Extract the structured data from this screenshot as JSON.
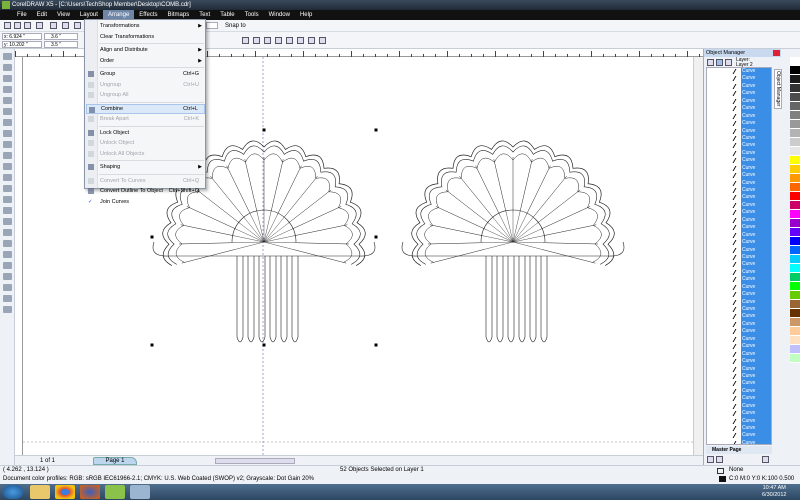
{
  "window": {
    "title": "CorelDRAW X5 - [C:\\Users\\TechShop Member\\Desktop\\COMB.cdr]"
  },
  "menubar": [
    "File",
    "Edit",
    "View",
    "Layout",
    "Arrange",
    "Effects",
    "Bitmaps",
    "Text",
    "Table",
    "Tools",
    "Window",
    "Help"
  ],
  "toolbar": {
    "snap_to": "Snap to"
  },
  "propbar": {
    "x": "x: 6.924 \"",
    "y": "y: 10.202 \"",
    "w": "3.6 \"",
    "h": "3.5 \""
  },
  "arrange_menu": [
    {
      "label": "Transformations",
      "submenu": true,
      "enabled": true
    },
    {
      "label": "Clear Transformations",
      "enabled": true
    },
    {
      "sep": true
    },
    {
      "label": "Align and Distribute",
      "submenu": true,
      "enabled": true
    },
    {
      "label": "Order",
      "submenu": true,
      "enabled": true
    },
    {
      "sep": true
    },
    {
      "label": "Group",
      "shortcut": "Ctrl+G",
      "enabled": true
    },
    {
      "label": "Ungroup",
      "shortcut": "Ctrl+U",
      "enabled": false
    },
    {
      "label": "Ungroup All",
      "enabled": false
    },
    {
      "sep": true
    },
    {
      "label": "Combine",
      "shortcut": "Ctrl+L",
      "enabled": true,
      "highlighted": true
    },
    {
      "label": "Break Apart",
      "shortcut": "Ctrl+K",
      "enabled": false
    },
    {
      "sep": true
    },
    {
      "label": "Lock Object",
      "enabled": true
    },
    {
      "label": "Unlock Object",
      "enabled": false
    },
    {
      "label": "Unlock All Objects",
      "enabled": false
    },
    {
      "sep": true
    },
    {
      "label": "Shaping",
      "submenu": true,
      "enabled": true
    },
    {
      "sep": true
    },
    {
      "label": "Convert To Curves",
      "shortcut": "Ctrl+Q",
      "enabled": false
    },
    {
      "label": "Convert Outline To Object",
      "shortcut": "Ctrl+Shift+Q",
      "enabled": true
    },
    {
      "label": "Join Curves",
      "enabled": true,
      "checked": true
    }
  ],
  "object_manager": {
    "title": "Object Manager",
    "layer_label": "Layer:",
    "layer": "Layer 2",
    "item_label": "Curve",
    "item_count": 52,
    "master_page": "Master Page",
    "side_tab": "Object Manager"
  },
  "pagebar": {
    "page_count": "1 of 1",
    "page_tab": "Page 1"
  },
  "status": {
    "coords": "( 4.262 , 13.124 )",
    "selection": "52 Objects Selected on Layer 1",
    "color_profiles": "Document color profiles: RGB: sRGB IEC61966-2.1; CMYK: U.S. Web Coated (SWOP) v2; Grayscale: Dot Gain 20%",
    "fill": "None",
    "outline": "C:0 M:0 Y:0 K:100  0.500 pt"
  },
  "taskbar": {
    "time": "10:47 AM",
    "date": "6/30/2012"
  },
  "palette": [
    "#ffffff",
    "#000000",
    "#1a1a1a",
    "#333333",
    "#4d4d4d",
    "#666666",
    "#808080",
    "#999999",
    "#b3b3b3",
    "#cccccc",
    "#e6e6e6",
    "#ffff00",
    "#ffcc00",
    "#ff9900",
    "#ff6600",
    "#ff0000",
    "#cc0066",
    "#ff00ff",
    "#9900cc",
    "#6600ff",
    "#0000ff",
    "#0066ff",
    "#00ccff",
    "#00ffff",
    "#00cc66",
    "#00ff00",
    "#66cc00",
    "#996633",
    "#663300",
    "#cc9966",
    "#ffcc99",
    "#ffe0c0",
    "#c0c0ff",
    "#c0ffc0"
  ]
}
